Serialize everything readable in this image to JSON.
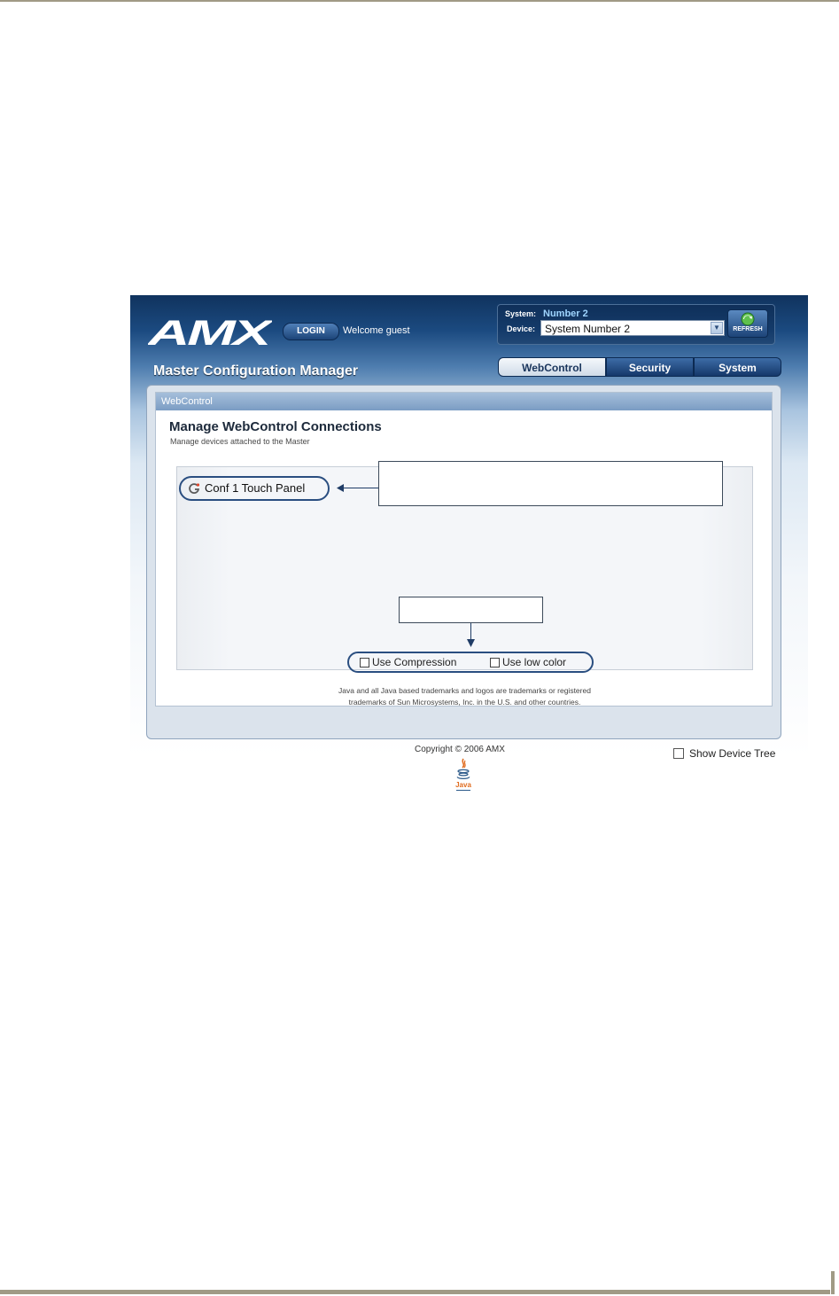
{
  "header": {
    "logo_text": "AMX",
    "login_label": "LOGIN",
    "welcome_text": "Welcome guest",
    "app_title": "Master Configuration Manager"
  },
  "system_box": {
    "system_label": "System:",
    "system_value": "Number 2",
    "device_label": "Device:",
    "device_value": "System Number 2",
    "refresh_label": "REFRESH"
  },
  "tabs": [
    {
      "label": "WebControl",
      "active": true
    },
    {
      "label": "Security",
      "active": false
    },
    {
      "label": "System",
      "active": false
    }
  ],
  "panel": {
    "header": "WebControl",
    "title": "Manage WebControl Connections",
    "subtitle": "Manage devices attached to the Master"
  },
  "applet": {
    "device_name": "Conf 1 Touch Panel",
    "options": [
      {
        "label": "Use Compression",
        "checked": false
      },
      {
        "label": "Use low color",
        "checked": false
      }
    ],
    "trademark_line1": "Java and all Java based trademarks and logos are trademarks or registered",
    "trademark_line2": "trademarks of Sun Microsystems, Inc. in the U.S. and other countries."
  },
  "footer": {
    "copyright": "Copyright © 2006 AMX",
    "java_text": "Java",
    "show_device_tree_label": "Show Device Tree",
    "show_device_tree_checked": false
  },
  "colors": {
    "header_dark": "#10335e",
    "accent_blue": "#2a4e80",
    "page_rule": "#a09a85"
  },
  "icons": [
    "refresh-icon",
    "device-connect-icon",
    "select-arrow-icon",
    "java-logo-icon"
  ]
}
